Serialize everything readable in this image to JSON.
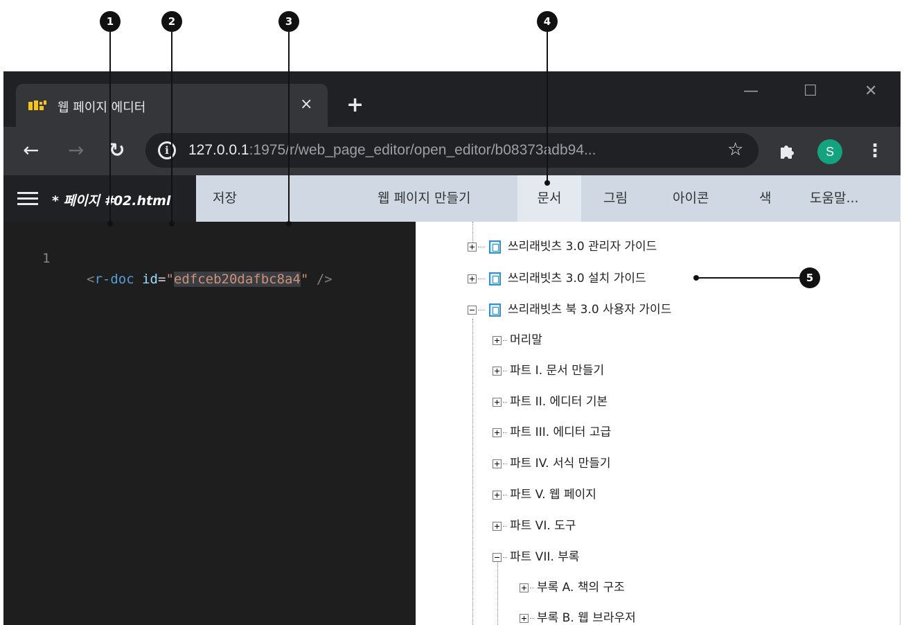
{
  "callouts": [
    "1",
    "2",
    "3",
    "4",
    "5"
  ],
  "browser": {
    "tab_title": "웹 페이지 에디터",
    "tab_close": "×",
    "new_tab": "+",
    "window_controls": {
      "minimize": "—",
      "maximize": "☐",
      "close": "✕"
    },
    "back": "←",
    "forward": "→",
    "reload": "↻",
    "info_icon": "i",
    "url_host": "127.0.0.1",
    "url_rest": ":1975/r/web_page_editor/open_editor/b08373adb94...",
    "star": "☆",
    "profile_initial": "S",
    "menu": "⋮"
  },
  "editor": {
    "doc_title": "* 페이지 #02.html",
    "menu": [
      "저장",
      "웹 페이지 만들기",
      "문서",
      "그림",
      "아이콘",
      "색",
      "도움말..."
    ],
    "active_menu": "문서"
  },
  "code": {
    "line_number": "1",
    "open": "<",
    "tag": "r-doc",
    "attr": "id",
    "eq": "=",
    "quote": "\"",
    "value": "edfceb20dafbc8a4",
    "close": " />"
  },
  "tree": {
    "items": [
      {
        "label": "쓰리래빗츠 3.0 관리자 가이드"
      },
      {
        "label": "쓰리래빗츠 3.0 설치 가이드"
      },
      {
        "label": "쓰리래빗츠 북 3.0 사용자 가이드"
      },
      {
        "label": "머리말"
      },
      {
        "label": "파트 I. 문서 만들기"
      },
      {
        "label": "파트 II. 에디터 기본"
      },
      {
        "label": "파트 III. 에디터 고급"
      },
      {
        "label": "파트 IV. 서식 만들기"
      },
      {
        "label": "파트 V. 웹 페이지"
      },
      {
        "label": "파트 VI. 도구"
      },
      {
        "label": "파트 VII. 부록"
      },
      {
        "label": "부록 A. 책의 구조"
      },
      {
        "label": "부록 B. 웹 브라우저"
      }
    ]
  },
  "colors": {
    "menubar": "#cfd8e3",
    "code_background": "#1e1e1e",
    "profile": "#14a37f",
    "book_icon": "#2b8fd6"
  }
}
